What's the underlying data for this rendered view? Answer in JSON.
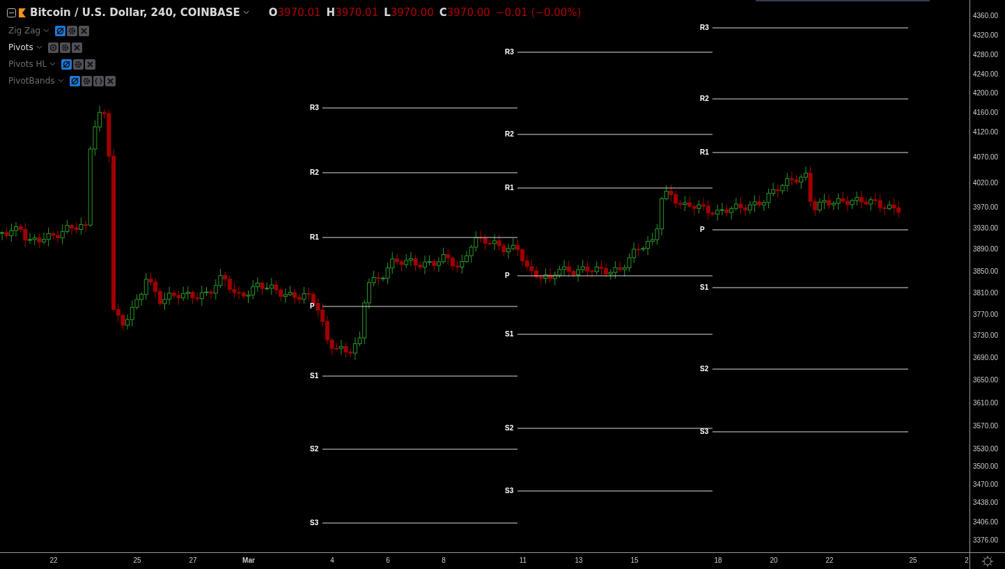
{
  "header": {
    "title": "Bitcoin / U.S. Dollar, 240, COINBASE",
    "ohlc": [
      {
        "key": "O",
        "value": "3970.01"
      },
      {
        "key": "H",
        "value": "3970.01"
      },
      {
        "key": "L",
        "value": "3970.00"
      },
      {
        "key": "C",
        "value": "3970.00"
      }
    ],
    "change": "−0.01 (−0.00%)"
  },
  "indicators": [
    {
      "name": "Zig Zag",
      "hidden": true,
      "buttons": [
        {
          "kind": "visibility"
        },
        {
          "kind": "settings"
        },
        {
          "kind": "remove"
        }
      ]
    },
    {
      "name": "Pivots",
      "hidden": false,
      "buttons": [
        {
          "kind": "visibility"
        },
        {
          "kind": "settings"
        },
        {
          "kind": "remove"
        }
      ]
    },
    {
      "name": "Pivots HL",
      "hidden": true,
      "buttons": [
        {
          "kind": "visibility"
        },
        {
          "kind": "settings"
        },
        {
          "kind": "remove"
        }
      ]
    },
    {
      "name": "PivotBands",
      "hidden": true,
      "buttons": [
        {
          "kind": "visibility"
        },
        {
          "kind": "settings"
        },
        {
          "kind": "source"
        },
        {
          "kind": "remove"
        }
      ]
    }
  ],
  "pivot_periods": [
    {
      "levels": [
        "R3",
        "R2",
        "R1",
        "P",
        "S1",
        "S2",
        "S3"
      ]
    },
    {
      "levels": [
        "R3",
        "R2",
        "R1",
        "P",
        "S1",
        "S2",
        "S3"
      ]
    },
    {
      "levels": [
        "R3",
        "R2",
        "R1",
        "P",
        "S1",
        "S2",
        "S3"
      ]
    }
  ],
  "price_axis": [
    "4360.00",
    "4320.00",
    "4280.00",
    "4240.00",
    "4200.00",
    "4160.00",
    "4120.00",
    "4070.00",
    "4020.00",
    "3970.00",
    "3930.00",
    "3890.00",
    "3850.00",
    "3810.00",
    "3770.00",
    "3730.00",
    "3690.00",
    "3650.00",
    "3610.00",
    "3570.00",
    "3530.00",
    "3500.00",
    "3470.00",
    "3438.00",
    "3406.00",
    "3376.00"
  ],
  "time_axis": [
    {
      "label": "22",
      "kind": "day"
    },
    {
      "label": "25",
      "kind": "day"
    },
    {
      "label": "27",
      "kind": "day"
    },
    {
      "label": "Mar",
      "kind": "month"
    },
    {
      "label": "4",
      "kind": "day"
    },
    {
      "label": "6",
      "kind": "day"
    },
    {
      "label": "8",
      "kind": "day"
    },
    {
      "label": "11",
      "kind": "day"
    },
    {
      "label": "13",
      "kind": "day"
    },
    {
      "label": "15",
      "kind": "day"
    },
    {
      "label": "18",
      "kind": "day"
    },
    {
      "label": "20",
      "kind": "day"
    },
    {
      "label": "22",
      "kind": "day"
    },
    {
      "label": "25",
      "kind": "day"
    },
    {
      "label": "2",
      "kind": "day"
    }
  ]
}
